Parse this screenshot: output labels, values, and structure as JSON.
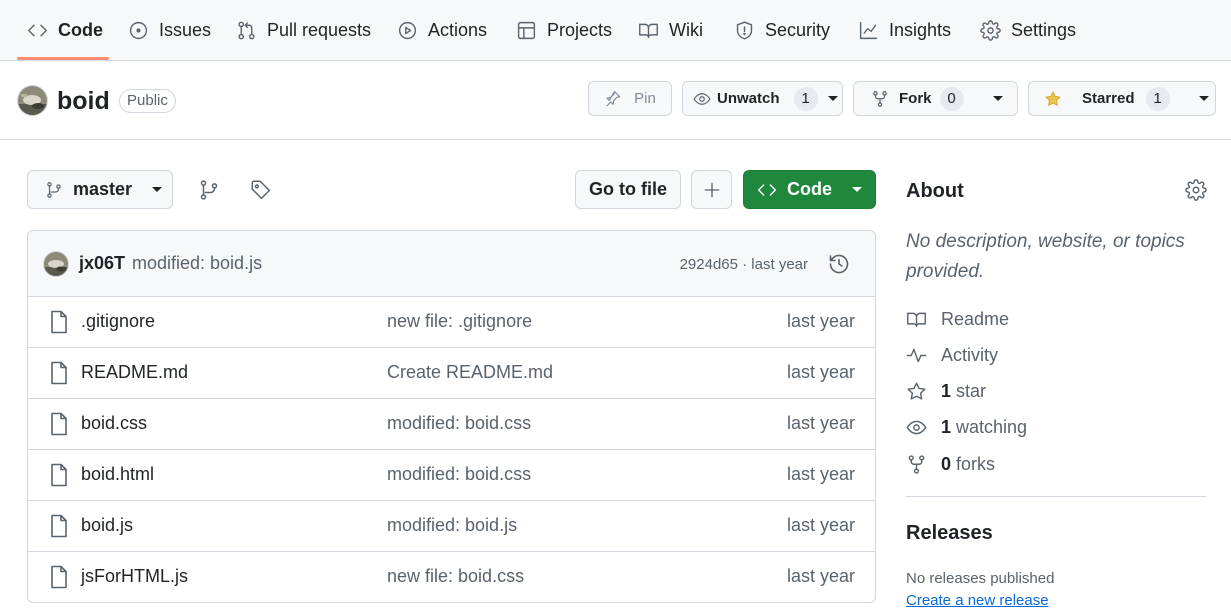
{
  "nav": {
    "items": [
      {
        "label": "Code",
        "icon": "code-icon",
        "active": true
      },
      {
        "label": "Issues",
        "icon": "issue-opened-icon"
      },
      {
        "label": "Pull requests",
        "icon": "git-pull-request-icon"
      },
      {
        "label": "Actions",
        "icon": "play-icon"
      },
      {
        "label": "Projects",
        "icon": "table-icon"
      },
      {
        "label": "Wiki",
        "icon": "book-icon"
      },
      {
        "label": "Security",
        "icon": "shield-icon"
      },
      {
        "label": "Insights",
        "icon": "graph-icon"
      },
      {
        "label": "Settings",
        "icon": "gear-icon"
      }
    ]
  },
  "repo": {
    "name": "boid",
    "visibility": "Public",
    "pin_label": "Pin",
    "watch_label": "Unwatch",
    "watch_count": "1",
    "fork_label": "Fork",
    "fork_count": "0",
    "star_label": "Starred",
    "star_count": "1",
    "star_color": "#eac54f"
  },
  "toolbar": {
    "branch": "master",
    "go_to_file": "Go to file",
    "add_icon": "plus-icon",
    "code_label": "Code"
  },
  "latest_commit": {
    "author": "jx06T",
    "message": "modified: boid.js",
    "meta": "2924d65 · last year"
  },
  "files": [
    {
      "name": ".gitignore",
      "commit": "new file: .gitignore",
      "time": "last year"
    },
    {
      "name": "README.md",
      "commit": "Create README.md",
      "time": "last year"
    },
    {
      "name": "boid.css",
      "commit": "modified: boid.css",
      "time": "last year"
    },
    {
      "name": "boid.html",
      "commit": "modified: boid.css",
      "time": "last year"
    },
    {
      "name": "boid.js",
      "commit": "modified: boid.js",
      "time": "last year"
    },
    {
      "name": "jsForHTML.js",
      "commit": "new file: boid.css",
      "time": "last year"
    }
  ],
  "about": {
    "title": "About",
    "description": "No description, website, or topics provided.",
    "readme": "Readme",
    "activity": "Activity",
    "stars_num": "1",
    "stars_label": "star",
    "watching_num": "1",
    "watching_label": "watching",
    "forks_num": "0",
    "forks_label": "forks"
  },
  "releases": {
    "title": "Releases",
    "none": "No releases published",
    "create_link": "Create a new release"
  },
  "colors": {
    "accent_underline": "#fd8c73",
    "code_button": "#1f883d",
    "link": "#0969da"
  }
}
